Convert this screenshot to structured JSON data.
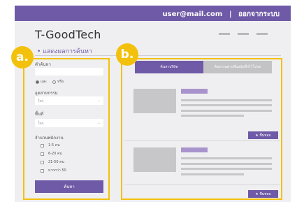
{
  "header": {
    "user_email": "user@mail.com",
    "separator": "|",
    "logout_label": "ออกจากระบบ"
  },
  "brand": {
    "logo_text": "T-GoodTech"
  },
  "search_results": {
    "heading": "• แสดงผลการค้นหา"
  },
  "callouts": {
    "a": "a.",
    "b": "b."
  },
  "filters": {
    "keyword_label": "คำค้นหา",
    "keyword_value": "",
    "logic_options": [
      {
        "label": "และ",
        "selected": true
      },
      {
        "label": "หรือ",
        "selected": false
      }
    ],
    "industry_label": "อุตสาหกรรม",
    "industry_value": "ใดๆ",
    "area_label": "พื้นที่",
    "area_value": "ใดๆ",
    "employees_label": "จำนวนพนักงาน",
    "employee_ranges": [
      "1-5 คน",
      "6-20 คน",
      "21-50 คน",
      "มากกว่า 50"
    ],
    "search_button": "ค้นหา"
  },
  "results": {
    "tabs": [
      {
        "label": "ค้นหาบริษัท",
        "active": true
      },
      {
        "label": "ค้นหาเฉพาะที่ผมบันทึกไว้โปรด",
        "active": false
      }
    ],
    "favorite_button": "★ ชื่นชอบ"
  },
  "colors": {
    "brand_purple": "#6f5aa7",
    "callout_yellow": "#f3c10b",
    "placeholder_gray": "#c7c7ca"
  }
}
